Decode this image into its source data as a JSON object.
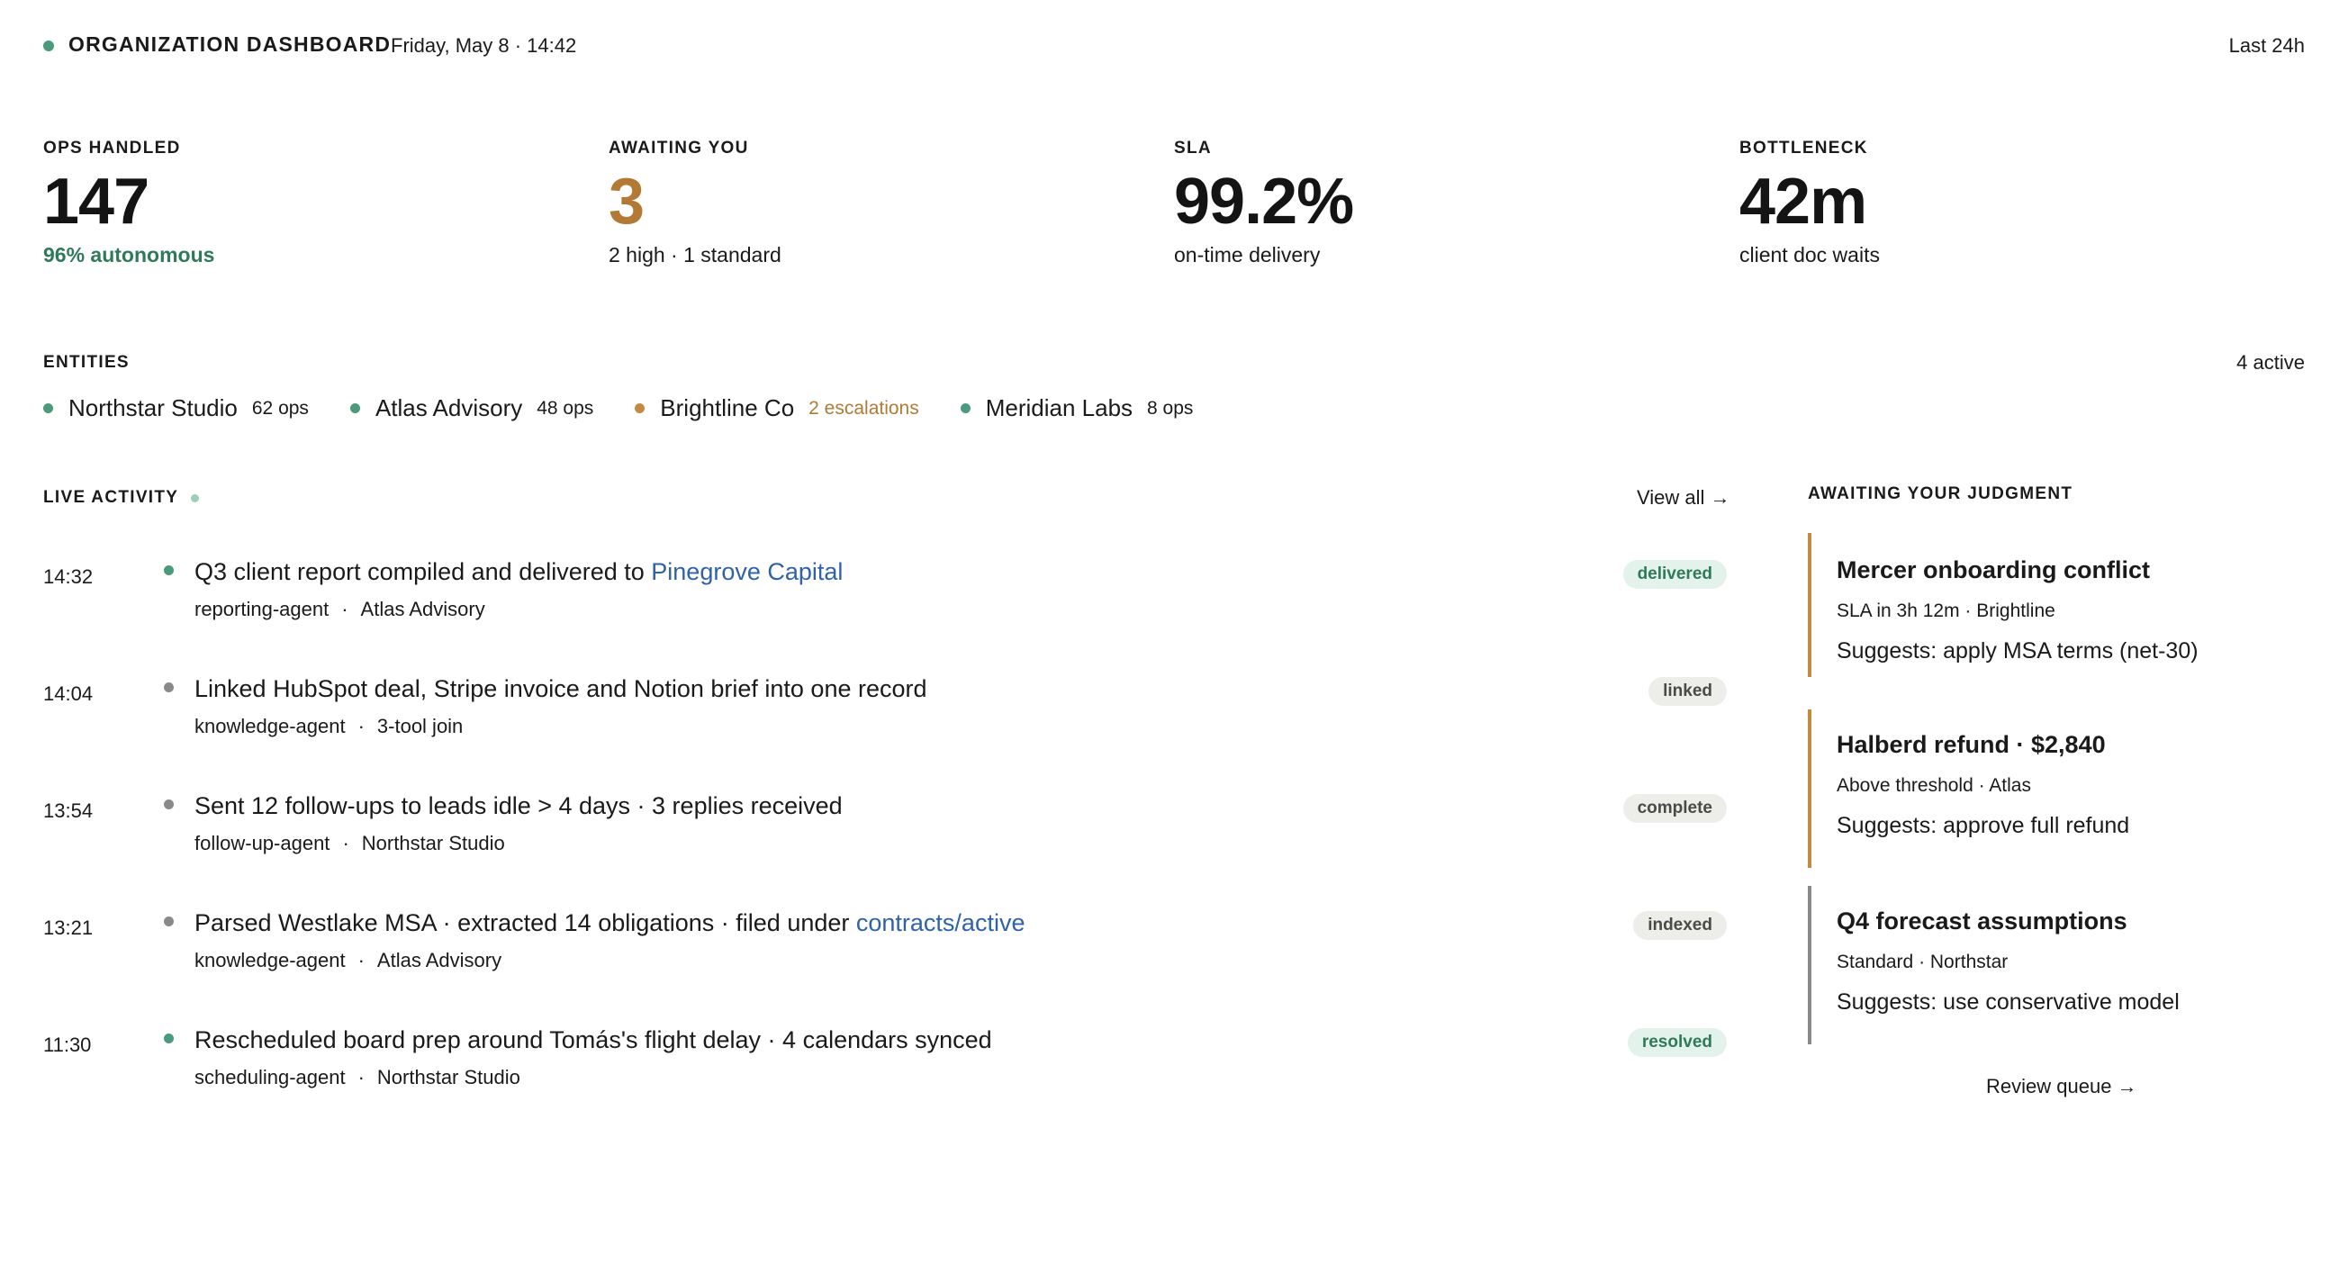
{
  "header": {
    "title": "ORGANIZATION DASHBOARD",
    "date": "Friday, May 8 · 14:42",
    "range": "Last 24h",
    "status_color": "#4a9a7c"
  },
  "stats": [
    {
      "label": "OPS HANDLED",
      "value": "147",
      "sub": "96% autonomous"
    },
    {
      "label": "AWAITING YOU",
      "value": "3",
      "sub": "2 high · 1 standard"
    },
    {
      "label": "SLA",
      "value": "99.2%",
      "sub": "on-time delivery"
    },
    {
      "label": "BOTTLENECK",
      "value": "42m",
      "sub": "client doc waits"
    }
  ],
  "entities": {
    "label": "ENTITIES",
    "active": "4 active",
    "items": [
      {
        "name": "Northstar Studio",
        "meta": "62 ops",
        "color": "#4a9a7c"
      },
      {
        "name": "Atlas Advisory",
        "meta": "48 ops",
        "color": "#4a9a7c"
      },
      {
        "name": "Brightline Co",
        "meta": "2 escalations",
        "color": "#c48a3f"
      },
      {
        "name": "Meridian Labs",
        "meta": "8 ops",
        "color": "#4a9a7c"
      }
    ]
  },
  "activity": {
    "label": "LIVE ACTIVITY",
    "view_all": "View all →",
    "items": [
      {
        "time": "14:32",
        "title": "Q3 client report compiled and delivered to ",
        "link": "Pinegrove Capital",
        "agent": "reporting-agent",
        "sep": "·",
        "context": "Atlas Advisory",
        "badge": "delivered",
        "dot_color": "#4a9a7c",
        "badge_bg": "#e3f2ea",
        "badge_fg": "#2f7a59"
      },
      {
        "time": "14:04",
        "title": "Linked HubSpot deal, Stripe invoice and Notion brief into one record",
        "link": "",
        "agent": "knowledge-agent",
        "sep": "·",
        "context": "3-tool join",
        "badge": "linked",
        "dot_color": "#8a8a8a",
        "badge_bg": "#ededea",
        "badge_fg": "#4a4a4a"
      },
      {
        "time": "13:54",
        "title": "Sent 12 follow-ups to leads idle > 4 days · 3 replies received",
        "link": "",
        "agent": "follow-up-agent",
        "sep": "·",
        "context": "Northstar Studio",
        "badge": "complete",
        "dot_color": "#8a8a8a",
        "badge_bg": "#ededea",
        "badge_fg": "#4a4a4a"
      },
      {
        "time": "13:21",
        "title": "Parsed Westlake MSA · extracted 14 obligations · filed under ",
        "link": "contracts/active",
        "agent": "knowledge-agent",
        "sep": "·",
        "context": "Atlas Advisory",
        "badge": "indexed",
        "dot_color": "#8a8a8a",
        "badge_bg": "#ededea",
        "badge_fg": "#4a4a4a"
      },
      {
        "time": "11:30",
        "title": "Rescheduled board prep around Tomás's flight delay · 4 calendars synced",
        "link": "",
        "agent": "scheduling-agent",
        "sep": "·",
        "context": "Northstar Studio",
        "badge": "resolved",
        "dot_color": "#4a9a7c",
        "badge_bg": "#e3f2ea",
        "badge_fg": "#2f7a59"
      }
    ]
  },
  "judgment": {
    "label": "AWAITING YOUR JUDGMENT",
    "review": "Review queue →",
    "items": [
      {
        "title": "Mercer onboarding conflict",
        "sub": "SLA in 3h 12m · Brightline",
        "suggestion": "Suggests: apply MSA terms (net-30)",
        "accent": "#c48a3f"
      },
      {
        "title": "Halberd refund · $2,840",
        "sub": "Above threshold · Atlas",
        "suggestion": "Suggests: approve full refund",
        "accent": "#c48a3f"
      },
      {
        "title": "Q4 forecast assumptions",
        "sub": "Standard · Northstar",
        "suggestion": "Suggests: use conservative model",
        "accent": "#8a8a8a"
      }
    ]
  }
}
